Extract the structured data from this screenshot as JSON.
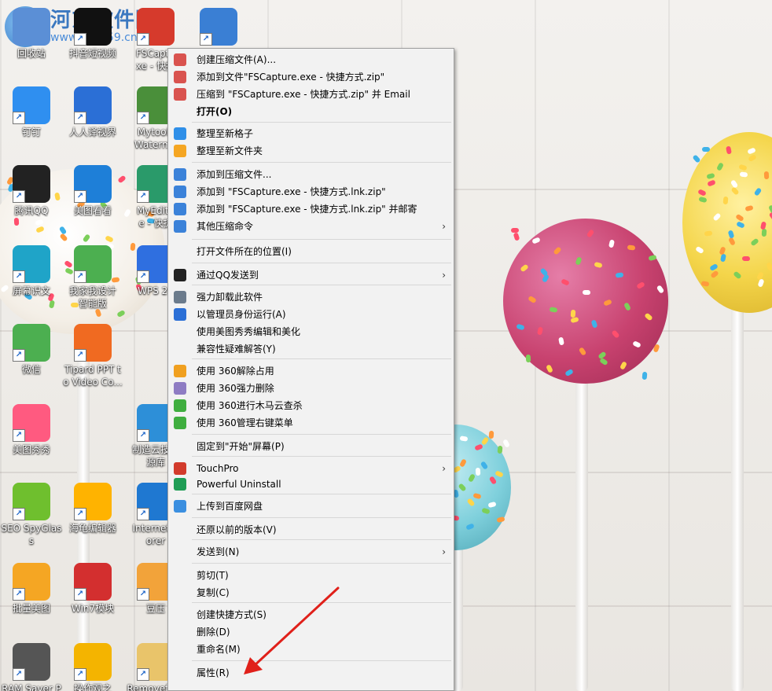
{
  "watermark": {
    "title": "河东软件园",
    "url": "www.pc0359.cn"
  },
  "desktop_icons": [
    {
      "label": "回收站",
      "icon": "recycle-bin-icon",
      "color": "#5b8fd6"
    },
    {
      "label": "抖音短视频",
      "icon": "douyin-icon",
      "color": "#111111"
    },
    {
      "label": "FSCaptu\nxe - 快捷",
      "icon": "fscapture-icon",
      "color": "#d63a2c"
    },
    {
      "label": "",
      "icon": "app-icon",
      "color": "#3a7fd4"
    },
    {
      "label": "钉钉",
      "icon": "dingtalk-icon",
      "color": "#2f8ff0"
    },
    {
      "label": "人人译视界",
      "icon": "translate-icon",
      "color": "#2b6fd6"
    },
    {
      "label": "Mytools\nWaterma",
      "icon": "mytools-icon",
      "color": "#4a8f3a"
    },
    {
      "label": "腾讯QQ",
      "icon": "qq-icon",
      "color": "#222222"
    },
    {
      "label": "美图看看",
      "icon": "meitu-kankan-icon",
      "color": "#1e7fd8"
    },
    {
      "label": "MyEdito\ne - 快捷",
      "icon": "myeditor-icon",
      "color": "#2a9a6a"
    },
    {
      "label": "屏幕识文",
      "icon": "screen-ocr-icon",
      "color": "#1fa4c8"
    },
    {
      "label": "我家我设计\n智能版",
      "icon": "home-design-icon",
      "color": "#4caf50"
    },
    {
      "label": "WPS 20",
      "icon": "wps-icon",
      "color": "#2f6fe0"
    },
    {
      "label": "微信",
      "icon": "wechat-icon",
      "color": "#4caf50"
    },
    {
      "label": "Tipard PPT t\no Video Co...",
      "icon": "tipard-icon",
      "color": "#f06a21"
    },
    {
      "label": "美图秀秀",
      "icon": "meitu-xiuxiu-icon",
      "color": "#ff5a80"
    },
    {
      "label": "制造云技术\n源库",
      "icon": "cloud-icon",
      "color": "#2d8fd8"
    },
    {
      "label": "SEO SpyGlas\ns",
      "icon": "seo-spyglass-icon",
      "color": "#6fbf2e"
    },
    {
      "label": "海龟编辑器",
      "icon": "python-editor-icon",
      "color": "#ffb300"
    },
    {
      "label": "Internet E\norer",
      "icon": "ie-icon",
      "color": "#1f78d1"
    },
    {
      "label": "批量美图",
      "icon": "batch-image-icon",
      "color": "#f5a623"
    },
    {
      "label": "Win7模块",
      "icon": "kao-icon",
      "color": "#d32f2f"
    },
    {
      "label": "豆压",
      "icon": "douya-icon",
      "color": "#f2a33a"
    },
    {
      "label": "RAM Saver P",
      "icon": "ram-saver-icon",
      "color": "#555555"
    },
    {
      "label": "操作观之",
      "icon": "hand-icon",
      "color": "#f4b400"
    },
    {
      "label": "Removefiles",
      "icon": "folder-icon",
      "color": "#e9c46a"
    }
  ],
  "menu": {
    "items": [
      {
        "label": "创建压缩文件(A)...",
        "icon": "archive-icon",
        "color": "#d9534f"
      },
      {
        "label": "添加到文件\"FSCapture.exe - 快捷方式.zip\"",
        "icon": "archive-icon",
        "color": "#d9534f"
      },
      {
        "label": "压缩到 \"FSCapture.exe - 快捷方式.zip\" 并 Email",
        "icon": "archive-icon",
        "color": "#d9534f"
      },
      {
        "label": "打开(O)",
        "icon": "",
        "color": "",
        "bold": true
      },
      {
        "label": "整理至新格子",
        "icon": "grid-icon",
        "color": "#2f8fe8"
      },
      {
        "label": "整理至新文件夹",
        "icon": "folder-add-icon",
        "color": "#f5a623"
      },
      {
        "label": "添加到压缩文件...",
        "icon": "zip-icon",
        "color": "#3b82d9"
      },
      {
        "label": "添加到 \"FSCapture.exe - 快捷方式.lnk.zip\"",
        "icon": "zip-icon",
        "color": "#3b82d9"
      },
      {
        "label": "添加到 \"FSCapture.exe - 快捷方式.lnk.zip\" 并邮寄",
        "icon": "zip-icon",
        "color": "#3b82d9"
      },
      {
        "label": "其他压缩命令",
        "icon": "zip-icon",
        "color": "#3b82d9",
        "submenu": true
      },
      {
        "label": "打开文件所在的位置(I)",
        "icon": "",
        "color": ""
      },
      {
        "label": "通过QQ发送到",
        "icon": "qq-icon",
        "color": "#222222",
        "submenu": true
      },
      {
        "label": "强力卸载此软件",
        "icon": "trash-icon",
        "color": "#6b7b8c"
      },
      {
        "label": "以管理员身份运行(A)",
        "icon": "shield-icon",
        "color": "#2b6fd6"
      },
      {
        "label": "使用美图秀秀编辑和美化",
        "icon": "",
        "color": ""
      },
      {
        "label": "兼容性疑难解答(Y)",
        "icon": "",
        "color": ""
      },
      {
        "label": "使用 360解除占用",
        "icon": "unlock-360-icon",
        "color": "#f0a020"
      },
      {
        "label": "使用 360强力删除",
        "icon": "delete-360-icon",
        "color": "#8e7cc3"
      },
      {
        "label": "使用 360进行木马云查杀",
        "icon": "scan-360-icon",
        "color": "#3fae3f"
      },
      {
        "label": "使用 360管理右键菜单",
        "icon": "menu-360-icon",
        "color": "#3fae3f"
      },
      {
        "label": "固定到\"开始\"屏幕(P)",
        "icon": "",
        "color": ""
      },
      {
        "label": "TouchPro",
        "icon": "touchpro-icon",
        "color": "#d23b2c",
        "submenu": true
      },
      {
        "label": "Powerful Uninstall",
        "icon": "uninstall-icon",
        "color": "#1f9d55"
      },
      {
        "label": "上传到百度网盘",
        "icon": "baidu-pan-icon",
        "color": "#3b8fe0"
      },
      {
        "label": "还原以前的版本(V)",
        "icon": "",
        "color": ""
      },
      {
        "label": "发送到(N)",
        "icon": "",
        "color": "",
        "submenu": true
      },
      {
        "label": "剪切(T)",
        "icon": "",
        "color": ""
      },
      {
        "label": "复制(C)",
        "icon": "",
        "color": ""
      },
      {
        "label": "创建快捷方式(S)",
        "icon": "",
        "color": ""
      },
      {
        "label": "删除(D)",
        "icon": "",
        "color": ""
      },
      {
        "label": "重命名(M)",
        "icon": "",
        "color": ""
      },
      {
        "label": "属性(R)",
        "icon": "",
        "color": ""
      }
    ],
    "submenu_arrow": "›"
  },
  "annotation": {
    "arrow_color": "#e0201a"
  }
}
